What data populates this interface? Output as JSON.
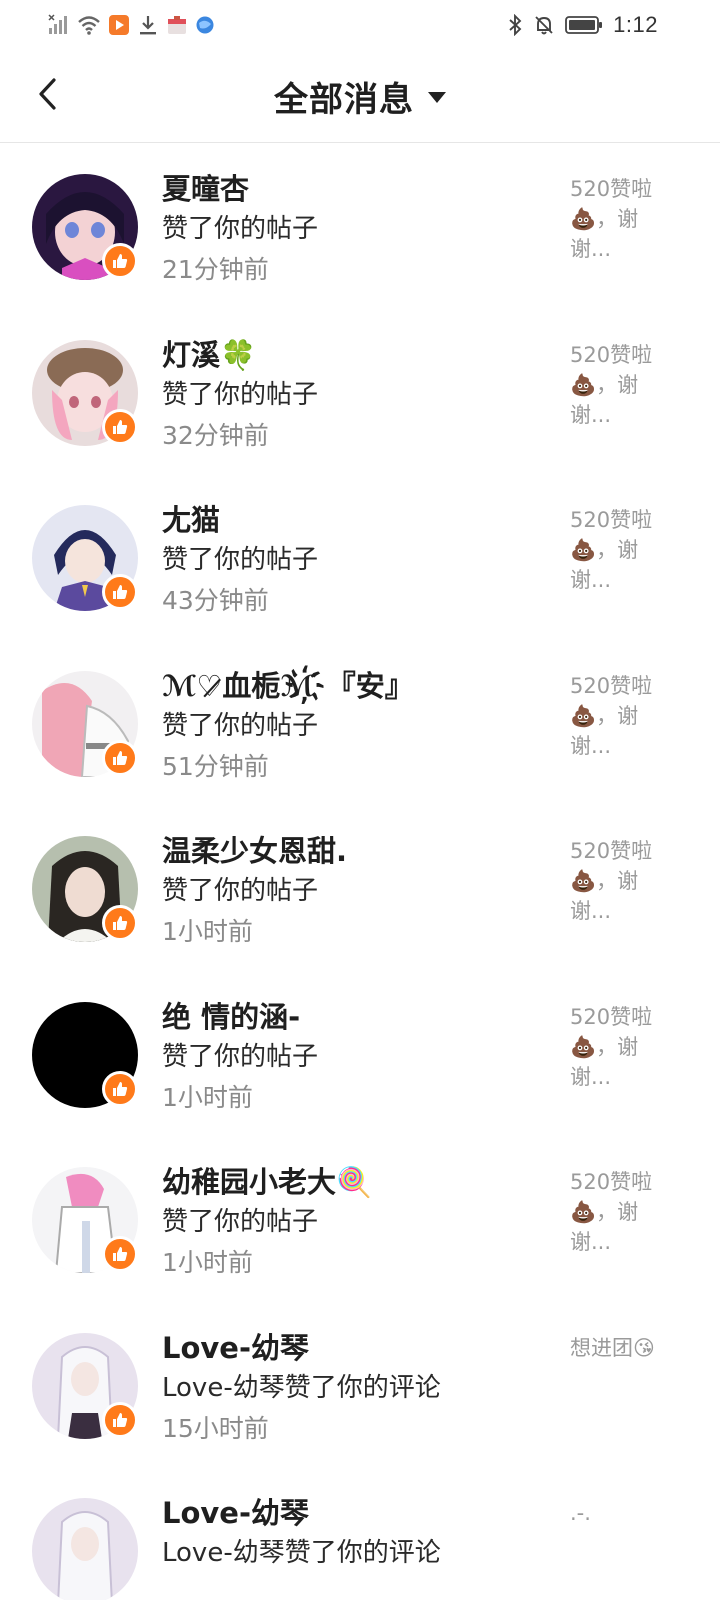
{
  "status_bar": {
    "time": "1:12"
  },
  "header": {
    "title": "全部消息",
    "back_icon": "back-arrow-icon",
    "dropdown_icon": "caret-down-icon"
  },
  "colors": {
    "like_badge": "#ff7a1a",
    "name_text": "#1f1f1f",
    "time_text": "#8a8a8a",
    "preview_text": "#9a9a9a"
  },
  "messages": [
    {
      "name": "夏曈杏",
      "action": "赞了你的帖子",
      "time": "21分钟前",
      "preview": [
        "520赞啦",
        "💩，谢",
        "谢..."
      ]
    },
    {
      "name": "灯溪🍀",
      "action": "赞了你的帖子",
      "time": "32分钟前",
      "preview": [
        "520赞啦",
        "💩，谢",
        "谢..."
      ]
    },
    {
      "name": "尢猫",
      "action": "赞了你的帖子",
      "time": "43分钟前",
      "preview": [
        "520赞啦",
        "💩，谢",
        "谢..."
      ]
    },
    {
      "name": "ℳ♡̷血栀ℳ҉『安』",
      "action": "赞了你的帖子",
      "time": "51分钟前",
      "preview": [
        "520赞啦",
        "💩，谢",
        "谢..."
      ]
    },
    {
      "name": "温柔少女恩甜.",
      "action": "赞了你的帖子",
      "time": "1小时前",
      "preview": [
        "520赞啦",
        "💩，谢",
        "谢..."
      ]
    },
    {
      "name": "绝 情的涵-",
      "action": "赞了你的帖子",
      "time": "1小时前",
      "preview": [
        "520赞啦",
        "💩，谢",
        "谢..."
      ]
    },
    {
      "name": "幼稚园小老大🍭",
      "action": "赞了你的帖子",
      "time": "1小时前",
      "preview": [
        "520赞啦",
        "💩，谢",
        "谢..."
      ]
    },
    {
      "name": "Love-幼琴",
      "action": "Love-幼琴赞了你的评论",
      "time": "15小时前",
      "preview": [
        "想进团😘"
      ]
    },
    {
      "name": "Love-幼琴",
      "action": "Love-幼琴赞了你的评论",
      "time": "",
      "preview": [
        ".-."
      ]
    }
  ]
}
